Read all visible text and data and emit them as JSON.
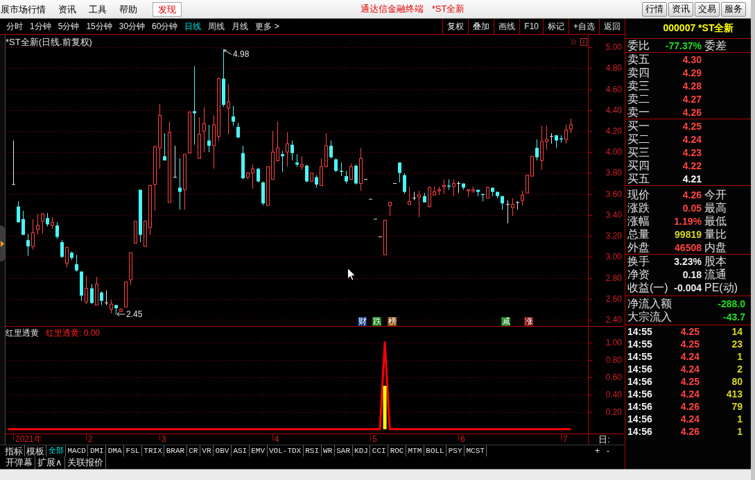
{
  "menu_bar": {
    "items": [
      {
        "label": "展市场行情",
        "kind": "menu"
      },
      {
        "label": "资讯",
        "kind": "menu"
      },
      {
        "label": "工具",
        "kind": "menu"
      },
      {
        "label": "帮助",
        "kind": "menu"
      },
      {
        "label": "发现",
        "kind": "highlight"
      }
    ],
    "app_title": "通达信金融终端",
    "security_title": "*ST全新",
    "buttons": [
      "行情",
      "资讯",
      "交易",
      "服务"
    ]
  },
  "period_bar": {
    "tabs": [
      {
        "label": "分时",
        "selected": false
      },
      {
        "label": "1分钟",
        "selected": false
      },
      {
        "label": "5分钟",
        "selected": false
      },
      {
        "label": "15分钟",
        "selected": false
      },
      {
        "label": "30分钟",
        "selected": false
      },
      {
        "label": "60分钟",
        "selected": false
      },
      {
        "label": "日线",
        "selected": true
      },
      {
        "label": "周线",
        "selected": false
      },
      {
        "label": "月线",
        "selected": false
      },
      {
        "label": "更多 >",
        "selected": false
      }
    ],
    "tools": [
      "复权",
      "叠加",
      "画线",
      "F10",
      "标记",
      "+自选",
      "返回"
    ]
  },
  "main_chart": {
    "title": "*ST全新(日线.前复权)",
    "high_label": "4.98",
    "low_label": "2.45",
    "event_tags": [
      {
        "label": "财",
        "color": "#103c80"
      },
      {
        "label": "跌",
        "color": "#107a10"
      },
      {
        "label": "榜",
        "color": "#8a4a12"
      },
      {
        "label": "减",
        "color": "#107a10"
      },
      {
        "label": "涨",
        "color": "#7a0808"
      }
    ],
    "chart_data": {
      "type": "candlestick",
      "categories": [
        null,
        null,
        null,
        null,
        null,
        null,
        null,
        null,
        null,
        null,
        null,
        null,
        null,
        null,
        null,
        null,
        null,
        null,
        null,
        null,
        null,
        null,
        null,
        null,
        null,
        null,
        null,
        null,
        null,
        null,
        null,
        null,
        null,
        null,
        null,
        null,
        null,
        null,
        null,
        null,
        null,
        null,
        null,
        null,
        null,
        null,
        null,
        null,
        null,
        null,
        null,
        null,
        null,
        null,
        null,
        null,
        null,
        null,
        null,
        null,
        null,
        null,
        null,
        null,
        null,
        null,
        null,
        null,
        null,
        null,
        null,
        null,
        null,
        null,
        null,
        null,
        null,
        null,
        null,
        null,
        null,
        null,
        null,
        null,
        null,
        null,
        null,
        null,
        null,
        null,
        null,
        null,
        null,
        null,
        null,
        null,
        null,
        null,
        null,
        null,
        null,
        null,
        null,
        null,
        null,
        null,
        null,
        null,
        null,
        null,
        null,
        null,
        null,
        null,
        null,
        null,
        null,
        null,
        null
      ],
      "ohlc": [
        null,
        [
          3.69,
          4.11,
          3.69,
          3.69
        ],
        [
          3.48,
          3.53,
          3.33,
          3.33
        ],
        [
          3.36,
          3.44,
          3.21,
          3.21
        ],
        [
          3.16,
          3.22,
          3.01,
          3.1
        ],
        [
          3.1,
          3.36,
          3.07,
          3.23
        ],
        [
          3.26,
          3.41,
          3.21,
          3.3
        ],
        [
          3.34,
          3.41,
          3.22,
          3.41
        ],
        [
          3.37,
          3.42,
          3.29,
          3.31
        ],
        [
          3.3,
          3.38,
          3.27,
          3.33
        ],
        [
          3.3,
          3.33,
          3.17,
          3.19
        ],
        [
          3.14,
          3.16,
          2.99,
          3.0
        ],
        [
          2.94,
          3.09,
          2.9,
          3.09
        ],
        [
          3.04,
          3.05,
          2.97,
          2.99
        ],
        [
          2.93,
          3.02,
          2.86,
          2.87
        ],
        [
          2.86,
          2.86,
          2.58,
          2.63
        ],
        [
          2.57,
          2.82,
          2.55,
          2.7
        ],
        [
          2.7,
          2.74,
          2.55,
          2.56
        ],
        [
          2.54,
          2.81,
          2.54,
          2.74
        ],
        [
          2.66,
          2.67,
          2.54,
          2.58
        ],
        [
          2.56,
          2.68,
          2.54,
          2.56
        ],
        [
          2.5,
          2.59,
          2.46,
          2.55
        ],
        [
          2.54,
          2.54,
          2.45,
          2.51
        ],
        [
          2.48,
          2.51,
          2.47,
          2.5
        ],
        [
          2.52,
          2.76,
          2.52,
          2.76
        ],
        [
          2.78,
          3.04,
          2.73,
          3.04
        ],
        [
          3.13,
          3.34,
          3.13,
          3.34
        ],
        [
          3.64,
          3.64,
          3.14,
          3.21
        ],
        [
          3.1,
          3.35,
          3.1,
          3.34
        ],
        [
          3.28,
          3.69,
          3.21,
          3.68
        ],
        [
          3.69,
          4.06,
          3.44,
          4.05
        ],
        [
          4.04,
          4.46,
          3.84,
          4.35
        ],
        [
          3.96,
          4.18,
          3.92,
          3.92
        ],
        [
          3.52,
          4.29,
          3.52,
          4.19
        ],
        [
          3.76,
          4.06,
          3.76,
          3.76
        ],
        [
          3.66,
          3.94,
          3.45,
          3.62
        ],
        [
          3.64,
          3.98,
          3.45,
          3.98
        ],
        [
          3.99,
          4.39,
          3.99,
          4.38
        ],
        [
          4.39,
          4.82,
          4.07,
          4.37
        ],
        [
          3.94,
          4.33,
          3.94,
          4.17
        ],
        [
          4.2,
          4.43,
          4.0,
          4.27
        ],
        [
          4.11,
          4.26,
          4.0,
          4.06
        ],
        [
          4.06,
          4.35,
          3.84,
          4.26
        ],
        [
          4.15,
          4.71,
          4.11,
          4.7
        ],
        [
          4.7,
          4.98,
          4.43,
          4.45
        ],
        [
          4.42,
          4.65,
          4.17,
          4.48
        ],
        [
          4.34,
          4.44,
          4.25,
          4.29
        ],
        [
          4.24,
          4.28,
          4.13,
          4.14
        ],
        [
          3.99,
          4.06,
          3.74,
          3.75
        ],
        [
          3.76,
          3.81,
          3.74,
          3.8
        ],
        [
          3.8,
          3.88,
          3.65,
          3.84
        ],
        [
          3.84,
          3.85,
          3.71,
          3.72
        ],
        [
          3.71,
          3.72,
          3.49,
          3.51
        ],
        [
          3.49,
          3.86,
          3.49,
          3.86
        ],
        [
          3.74,
          4.2,
          3.74,
          4.0
        ],
        [
          3.92,
          4.29,
          3.91,
          4.04
        ],
        [
          3.98,
          4.01,
          3.81,
          3.96
        ],
        [
          4.0,
          4.19,
          3.86,
          4.08
        ],
        [
          4.07,
          4.11,
          3.92,
          3.99
        ],
        [
          3.9,
          3.98,
          3.86,
          3.88
        ],
        [
          3.86,
          3.96,
          3.83,
          3.88
        ],
        [
          3.87,
          3.88,
          3.71,
          3.72
        ],
        [
          3.72,
          3.8,
          3.72,
          3.8
        ],
        [
          3.76,
          3.78,
          3.66,
          3.69
        ],
        [
          3.68,
          3.94,
          3.68,
          3.86
        ],
        [
          3.86,
          4.18,
          3.86,
          4.06
        ],
        [
          4.06,
          4.11,
          3.94,
          3.95
        ],
        [
          3.93,
          3.94,
          3.81,
          3.82
        ],
        [
          3.82,
          3.9,
          3.77,
          3.81
        ],
        [
          3.77,
          3.82,
          3.7,
          3.72
        ],
        [
          3.74,
          3.89,
          3.74,
          3.86
        ],
        [
          3.87,
          3.88,
          3.69,
          3.7
        ],
        [
          3.7,
          4.04,
          3.63,
          3.94
        ],
        [
          3.74,
          3.74,
          3.74,
          3.74
        ],
        [
          3.55,
          3.55,
          3.55,
          3.55
        ],
        [
          3.36,
          3.36,
          3.36,
          3.36
        ],
        [
          3.19,
          3.19,
          3.19,
          3.19
        ],
        [
          3.02,
          3.35,
          3.02,
          3.35
        ],
        [
          3.49,
          3.52,
          3.39,
          3.52
        ],
        [
          3.7,
          3.7,
          3.7,
          3.7
        ],
        [
          3.9,
          3.9,
          3.71,
          3.8
        ],
        [
          3.78,
          3.8,
          3.6,
          3.62
        ],
        [
          3.5,
          3.67,
          3.5,
          3.53
        ],
        [
          3.56,
          3.62,
          3.54,
          3.56
        ],
        [
          3.57,
          3.63,
          3.38,
          3.59
        ],
        [
          3.58,
          3.61,
          3.52,
          3.52
        ],
        [
          3.48,
          3.67,
          3.47,
          3.66
        ],
        [
          3.59,
          3.67,
          3.59,
          3.62
        ],
        [
          3.63,
          3.67,
          3.59,
          3.64
        ],
        [
          3.67,
          3.74,
          3.6,
          3.68
        ],
        [
          3.68,
          3.74,
          3.64,
          3.67
        ],
        [
          3.67,
          3.74,
          3.58,
          3.7
        ],
        [
          3.7,
          3.72,
          3.61,
          3.7
        ],
        [
          3.7,
          3.7,
          3.64,
          3.66
        ],
        [
          3.63,
          3.64,
          3.57,
          3.64
        ],
        [
          3.63,
          3.67,
          3.61,
          3.64
        ],
        [
          3.64,
          3.64,
          3.58,
          3.62
        ],
        [
          3.6,
          3.6,
          3.53,
          3.59
        ],
        [
          3.56,
          3.67,
          3.56,
          3.66
        ],
        [
          3.66,
          3.66,
          3.58,
          3.62
        ],
        [
          3.62,
          3.62,
          3.56,
          3.58
        ],
        [
          3.58,
          3.58,
          3.45,
          3.51
        ],
        [
          3.5,
          3.54,
          3.32,
          3.5
        ],
        [
          3.47,
          3.56,
          3.39,
          3.5
        ],
        [
          3.52,
          3.53,
          3.45,
          3.52
        ],
        [
          3.54,
          3.63,
          3.49,
          3.59
        ],
        [
          3.61,
          3.78,
          3.61,
          3.78
        ],
        [
          3.77,
          3.96,
          3.77,
          3.96
        ],
        [
          4.04,
          4.12,
          3.92,
          3.95
        ],
        [
          3.92,
          4.25,
          3.83,
          4.1
        ],
        [
          4.1,
          4.25,
          4.02,
          4.12
        ],
        [
          4.15,
          4.18,
          4.08,
          4.15
        ],
        [
          4.16,
          4.16,
          4.04,
          4.11
        ],
        [
          4.13,
          4.16,
          4.09,
          4.12
        ],
        [
          4.12,
          4.26,
          4.08,
          4.21
        ],
        [
          4.22,
          4.32,
          4.18,
          4.26
        ],
        null,
        null,
        null
      ],
      "ylim": [
        2.34,
        5.12
      ],
      "grid": true,
      "yticks": [
        {
          "value": 5,
          "label": "5.00"
        },
        {
          "value": 4.8,
          "label": "4.80"
        },
        {
          "value": 4.6,
          "label": "4.60"
        },
        {
          "value": 4.4,
          "label": "4.40"
        },
        {
          "value": 4.2,
          "label": "4.20"
        },
        {
          "value": 4,
          "label": "4.00"
        },
        {
          "value": 3.8,
          "label": "3.80"
        },
        {
          "value": 3.6,
          "label": "3.60"
        },
        {
          "value": 3.4,
          "label": "3.40"
        },
        {
          "value": 3.2,
          "label": "3.20"
        },
        {
          "value": 3,
          "label": "3.00"
        },
        {
          "value": 2.8,
          "label": "2.80"
        },
        {
          "value": 2.6,
          "label": "2.60"
        },
        {
          "value": 2.4,
          "label": "2.40"
        }
      ]
    }
  },
  "indicator": {
    "reading": "红里透黄: 0.00",
    "chart_data": {
      "type": "line",
      "categories": [
        null,
        null,
        null,
        null,
        null,
        null,
        null,
        null,
        null,
        null,
        null,
        null,
        null,
        null,
        null,
        null,
        null,
        null,
        null,
        null,
        null,
        null,
        null,
        null,
        null,
        null,
        null,
        null,
        null,
        null,
        null,
        null,
        null,
        null,
        null,
        null,
        null,
        null,
        null,
        null,
        null,
        null,
        null,
        null,
        null,
        null,
        null,
        null,
        null,
        null,
        null,
        null,
        null,
        null,
        null,
        null,
        null,
        null,
        null,
        null,
        null,
        null,
        null,
        null,
        null,
        null,
        null,
        null,
        null,
        null,
        null,
        null,
        null,
        null,
        null,
        null,
        null,
        null,
        null,
        null,
        null,
        null,
        null,
        null,
        null,
        null,
        null,
        null,
        null,
        null,
        null,
        null,
        null,
        null,
        null,
        null,
        null,
        null,
        null,
        null,
        null,
        null,
        null,
        null,
        null,
        null,
        null,
        null,
        null,
        null,
        null,
        null,
        null,
        null,
        null,
        null,
        null,
        null,
        null
      ],
      "series": [
        {
          "name": "红里透黄",
          "color": "#ff0000",
          "values": [
            0,
            0,
            0,
            0,
            0,
            0,
            0,
            0,
            0,
            0,
            0,
            0,
            0,
            0,
            0,
            0,
            0,
            0,
            0,
            0,
            0,
            0,
            0,
            0,
            0,
            0,
            0,
            0,
            0,
            0,
            0,
            0,
            0,
            0,
            0,
            0,
            0,
            0,
            0,
            0,
            0,
            0,
            0,
            0,
            0,
            0,
            0,
            0,
            0,
            0,
            0,
            0,
            0,
            0,
            0,
            0,
            0,
            0,
            0,
            0,
            0,
            0,
            0,
            0,
            0,
            0,
            0,
            0,
            0,
            0,
            0,
            0,
            0,
            0,
            0,
            0,
            0,
            1,
            0,
            0,
            0,
            0,
            0,
            0,
            0,
            0,
            0,
            0,
            0,
            0,
            0,
            0,
            0,
            0,
            0,
            0,
            0,
            0,
            0,
            0,
            0,
            0,
            0,
            0,
            0,
            0,
            0,
            0,
            0,
            0,
            0,
            0,
            0,
            0,
            0,
            0,
            null,
            null,
            null
          ]
        },
        {
          "type": "bar",
          "color": "#ffff00",
          "values": [
            null,
            null,
            null,
            null,
            null,
            null,
            null,
            null,
            null,
            null,
            null,
            null,
            null,
            null,
            null,
            null,
            null,
            null,
            null,
            null,
            null,
            null,
            null,
            null,
            null,
            null,
            null,
            null,
            null,
            null,
            null,
            null,
            null,
            null,
            null,
            null,
            null,
            null,
            null,
            null,
            null,
            null,
            null,
            null,
            null,
            null,
            null,
            null,
            null,
            null,
            null,
            null,
            null,
            null,
            null,
            null,
            null,
            null,
            null,
            null,
            null,
            null,
            null,
            null,
            null,
            null,
            null,
            null,
            null,
            null,
            null,
            null,
            null,
            null,
            null,
            null,
            null,
            0.5,
            null,
            null,
            null,
            null,
            null,
            null,
            null,
            null,
            null,
            null,
            null,
            null,
            null,
            null,
            null,
            null,
            null,
            null,
            null,
            null,
            null,
            null,
            null,
            null,
            null,
            null,
            null,
            null,
            null,
            null,
            null,
            null,
            null,
            null,
            null,
            null,
            null,
            null,
            null,
            null,
            null
          ]
        }
      ],
      "ylim": [
        -0.05,
        1.18
      ],
      "grid": true,
      "yticks": [
        {
          "value": 1,
          "label": "1.00"
        },
        {
          "value": 0.8,
          "label": "0.80"
        },
        {
          "value": 0.6,
          "label": "0.60"
        },
        {
          "value": 0.4,
          "label": "0.40"
        },
        {
          "value": 0.2,
          "label": "0.20"
        }
      ]
    }
  },
  "date_axis": {
    "labels": [
      "2021年",
      "2",
      "3",
      "4",
      "5",
      "6",
      "7"
    ],
    "period_label": "日:"
  },
  "indicator_bar": {
    "menus": [
      "指标",
      "模板"
    ],
    "tabs": [
      {
        "label": "全部",
        "selected": true
      },
      {
        "label": "MACD",
        "selected": false
      },
      {
        "label": "DMI",
        "selected": false
      },
      {
        "label": "DMA",
        "selected": false
      },
      {
        "label": "FSL",
        "selected": false
      },
      {
        "label": "TRIX",
        "selected": false
      },
      {
        "label": "BRAR",
        "selected": false
      },
      {
        "label": "CR",
        "selected": false
      },
      {
        "label": "VR",
        "selected": false
      },
      {
        "label": "OBV",
        "selected": false
      },
      {
        "label": "ASI",
        "selected": false
      },
      {
        "label": "EMV",
        "selected": false
      },
      {
        "label": "VOL-TDX",
        "selected": false
      },
      {
        "label": "RSI",
        "selected": false
      },
      {
        "label": "WR",
        "selected": false
      },
      {
        "label": "SAR",
        "selected": false
      },
      {
        "label": "KDJ",
        "selected": false
      },
      {
        "label": "CCI",
        "selected": false
      },
      {
        "label": "ROC",
        "selected": false
      },
      {
        "label": "MTM",
        "selected": false
      },
      {
        "label": "BOLL",
        "selected": false
      },
      {
        "label": "PSY",
        "selected": false
      },
      {
        "label": "MCST",
        "selected": false
      }
    ],
    "zoom_buttons": [
      "+",
      "-"
    ]
  },
  "extra_buttons": [
    "开弹幕",
    "扩展∧",
    "关联报价"
  ],
  "quote_panel": {
    "header": "000007 *ST全新",
    "order_ratio": {
      "label": "委比",
      "value": "-77.37%",
      "label_2": "委差"
    },
    "asks": [
      {
        "label": "卖五",
        "price": "4.30",
        "color": "#ff4444"
      },
      {
        "label": "卖四",
        "price": "4.29",
        "color": "#ff4444"
      },
      {
        "label": "卖三",
        "price": "4.28",
        "color": "#ff4444"
      },
      {
        "label": "卖二",
        "price": "4.27",
        "color": "#ff4444"
      },
      {
        "label": "卖一",
        "price": "4.26",
        "color": "#ff4444"
      }
    ],
    "bids": [
      {
        "label": "买一",
        "price": "4.25",
        "color": "#ff4444"
      },
      {
        "label": "买二",
        "price": "4.24",
        "color": "#ff4444"
      },
      {
        "label": "买三",
        "price": "4.23",
        "color": "#ff4444"
      },
      {
        "label": "买四",
        "price": "4.22",
        "color": "#ff4444"
      },
      {
        "label": "买五",
        "price": "4.21",
        "color": "#ffffff"
      }
    ],
    "quotes": [
      {
        "label": "现价",
        "value": "4.26",
        "label_2": "今开",
        "color": "#ff4444"
      },
      {
        "label": "涨跌",
        "value": "0.05",
        "label_2": "最高",
        "color": "#ff4444"
      },
      {
        "label": "涨幅",
        "value": "1.19%",
        "label_2": "最低",
        "color": "#ff4444"
      },
      {
        "label": "总量",
        "value": "99819",
        "label_2": "量比",
        "color": "#d8d820"
      },
      {
        "label": "外盘",
        "value": "46508",
        "label_2": "内盘",
        "color": "#ff4444"
      }
    ],
    "fundamentals": [
      {
        "label": "换手",
        "value": "3.23%",
        "label_2": "股本"
      },
      {
        "label": "净资",
        "value": "0.18",
        "label_2": "流通"
      },
      {
        "label": "收益(一)",
        "value": "-0.004",
        "label_2": "PE(动)"
      }
    ],
    "flows": [
      {
        "label": "净流入额",
        "value": "-288.0"
      },
      {
        "label": "大宗流入",
        "value": "-43.7"
      }
    ],
    "ticks": [
      {
        "time": "14:55",
        "price": "4.25",
        "volume": "14"
      },
      {
        "time": "14:55",
        "price": "4.25",
        "volume": "23"
      },
      {
        "time": "14:55",
        "price": "4.24",
        "volume": "1"
      },
      {
        "time": "14:56",
        "price": "4.24",
        "volume": "2"
      },
      {
        "time": "14:56",
        "price": "4.25",
        "volume": "80"
      },
      {
        "time": "14:56",
        "price": "4.24",
        "volume": "413"
      },
      {
        "time": "14:56",
        "price": "4.26",
        "volume": "79"
      },
      {
        "time": "14:56",
        "price": "4.24",
        "volume": "1"
      },
      {
        "time": "14:56",
        "price": "4.26",
        "volume": "1"
      }
    ]
  }
}
